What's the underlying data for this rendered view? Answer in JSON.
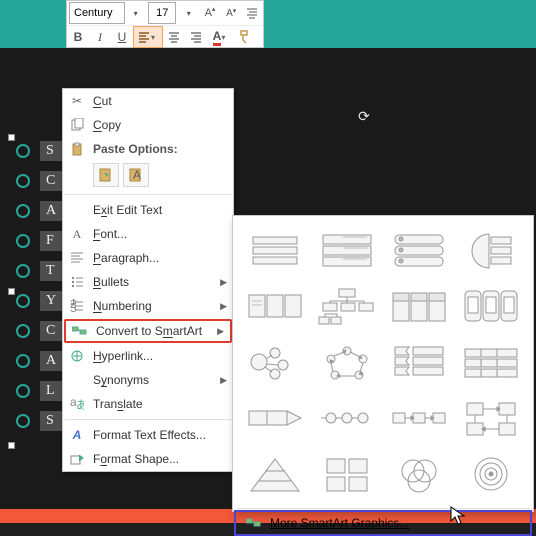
{
  "colors": {
    "accent": "#26a69a",
    "highlight_border": "#e23b2e",
    "footer_highlight": "#4b45d6",
    "bottom_bar": "#f2583a"
  },
  "toolbar": {
    "font_name": "Century",
    "font_size": "17",
    "increase_font": "A▴",
    "decrease_font": "A▾",
    "bold": "B",
    "italic": "I",
    "underline": "U"
  },
  "list": {
    "items": [
      "S",
      "C",
      "A",
      "F",
      "T",
      "Y",
      "C",
      "A",
      "L",
      "S"
    ]
  },
  "context_menu": {
    "cut": "Cut",
    "copy": "Copy",
    "paste_options": "Paste Options:",
    "exit_edit": "Exit Edit Text",
    "font": "Font...",
    "paragraph": "Paragraph...",
    "bullets": "Bullets",
    "numbering": "Numbering",
    "convert_smartart": "Convert to SmartArt",
    "hyperlink": "Hyperlink...",
    "synonyms": "Synonyms",
    "translate": "Translate",
    "format_text_effects": "Format Text Effects...",
    "format_shape": "Format Shape..."
  },
  "gallery": {
    "more": "More SmartArt Graphics..."
  }
}
